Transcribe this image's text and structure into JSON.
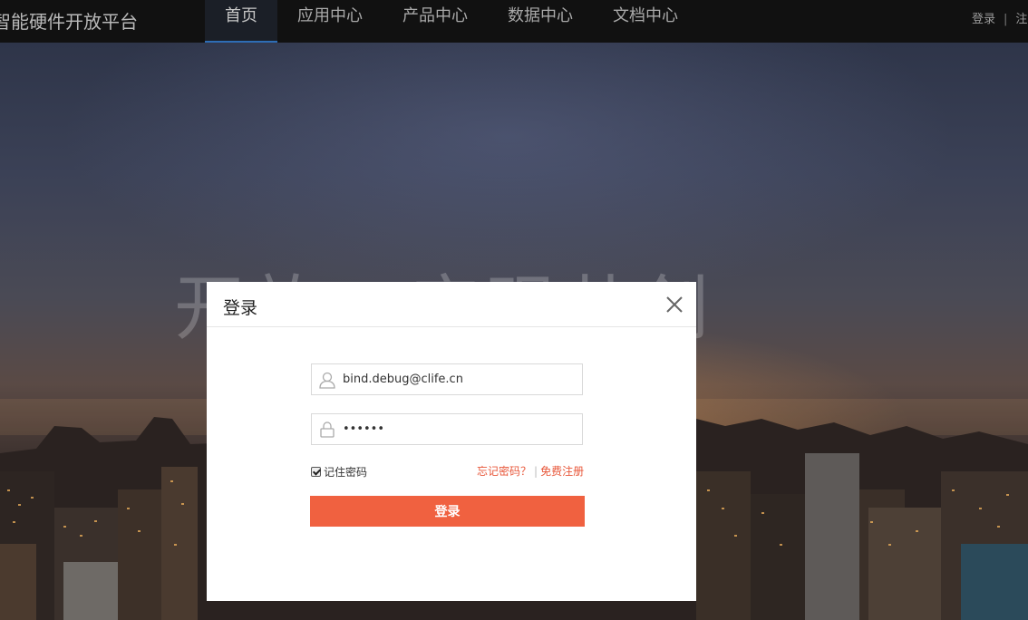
{
  "brand": {
    "title": "智能硬件开放平台"
  },
  "nav": {
    "items": [
      {
        "label": "首页"
      },
      {
        "label": "应用中心"
      },
      {
        "label": "产品中心"
      },
      {
        "label": "数据中心"
      },
      {
        "label": "文档中心"
      }
    ]
  },
  "auth": {
    "login": "登录",
    "separator": "|",
    "register": "注"
  },
  "hero": {
    "text": "开放 · 实现共创"
  },
  "modal": {
    "title": "登录",
    "username_value": "bind.debug@clife.cn",
    "password_value": "••••••",
    "remember_label": "记住密码",
    "remember_checked": true,
    "forgot_label": "忘记密码？",
    "links_separator": "|",
    "register_label": "免费注册",
    "submit_label": "登录"
  },
  "colors": {
    "accent": "#f06140",
    "link": "#e8573a",
    "topbar": "#111111",
    "nav_active_underline": "#2e6db5"
  },
  "icons": {
    "close": "close-icon",
    "user": "user-icon",
    "lock": "lock-icon"
  }
}
